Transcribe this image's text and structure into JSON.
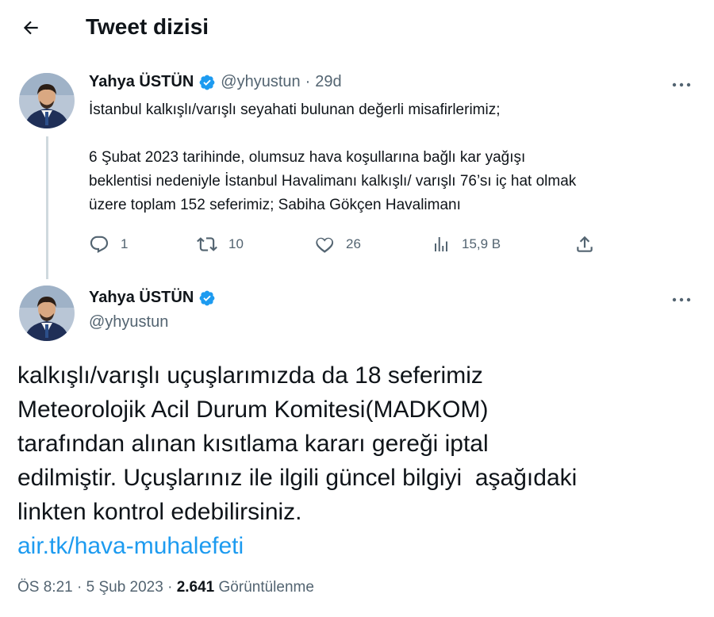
{
  "header": {
    "title": "Tweet dizisi"
  },
  "tweet1": {
    "author_name": "Yahya ÜSTÜN",
    "handle": "@yhyustun",
    "separator": "·",
    "time": "29d",
    "lines": [
      "İstanbul kalkışlı/varışlı seyahati bulunan değerli misafirlerimiz;",
      "6 Şubat 2023 tarihinde, olumsuz hava koşullarına bağlı kar yağışı",
      "beklentisi nedeniyle İstanbul Havalimanı kalkışlı/ varışlı 76’sı iç hat olmak",
      "üzere toplam 152 seferimiz; Sabiha Gökçen Havalimanı"
    ],
    "actions": {
      "replies": "1",
      "retweets": "10",
      "likes": "26",
      "views": "15,9 B"
    }
  },
  "tweet2": {
    "author_name": "Yahya ÜSTÜN",
    "handle": "@yhyustun",
    "lines": [
      "kalkışlı/varışlı uçuşlarımızda da 18 seferimiz",
      "Meteorolojik Acil Durum Komitesi(MADKOM)",
      "tarafından alınan kısıtlama kararı gereği iptal",
      "edilmiştir. Uçuşlarınız ile ilgili güncel bilgiyi  aşağıdaki",
      "linkten kontrol edebilirsiniz."
    ],
    "link": "air.tk/hava-muhalefeti",
    "time": "ÖS 8:21",
    "separator": "·",
    "date": "5 Şub 2023",
    "views_count": "2.641",
    "views_label": "Görüntülenme"
  },
  "colors": {
    "accent": "#1d9bf0",
    "secondary_text": "#536471",
    "thread_line": "#cfd9de"
  },
  "icons": [
    "back-arrow-icon",
    "verified-badge-icon",
    "more-icon",
    "reply-icon",
    "retweet-icon",
    "like-icon",
    "views-icon",
    "share-icon"
  ]
}
